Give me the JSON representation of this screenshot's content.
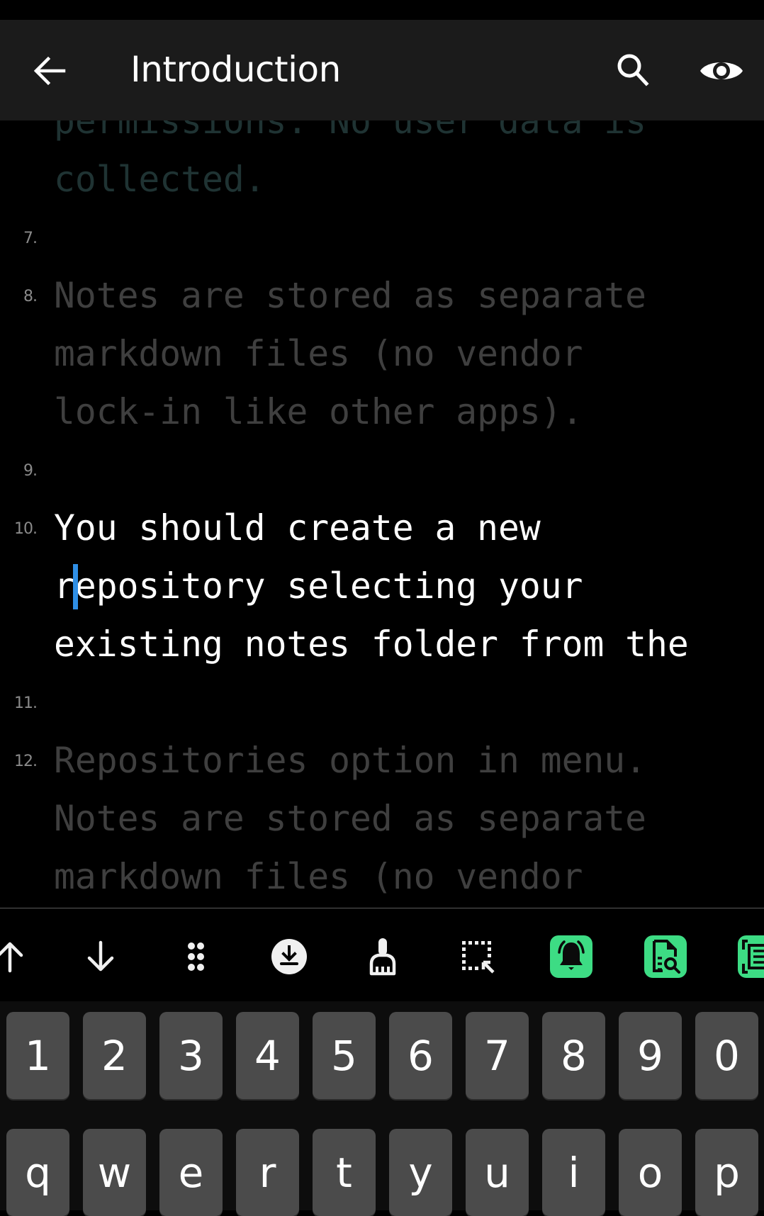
{
  "app_bar": {
    "title": "Introduction",
    "icons": [
      "back-arrow-icon",
      "search-icon",
      "eye-preview-icon"
    ]
  },
  "editor": {
    "lines": [
      {
        "number": "",
        "text": "permissions. No user data is",
        "style": "teal"
      },
      {
        "number": "",
        "text": "collected.",
        "style": "teal"
      },
      {
        "number": "7.",
        "text": "",
        "style": "dim"
      },
      {
        "number": "8.",
        "text": "Notes are stored as separate",
        "style": "dim"
      },
      {
        "number": "",
        "text": "markdown files (no vendor",
        "style": "dim"
      },
      {
        "number": "",
        "text": "lock-in like other apps).",
        "style": "dim"
      },
      {
        "number": "9.",
        "text": "",
        "style": "dim"
      },
      {
        "number": "10.",
        "text": "You should create a new",
        "style": "active"
      },
      {
        "number": "",
        "text": "repository selecting your",
        "style": "active"
      },
      {
        "number": "",
        "text": "existing notes folder from the",
        "style": "active"
      },
      {
        "number": "11.",
        "text": "",
        "style": "dim"
      },
      {
        "number": "12.",
        "text": "Repositories option in menu.",
        "style": "dim"
      },
      {
        "number": "",
        "text": "Notes are stored as separate",
        "style": "dim"
      },
      {
        "number": "",
        "text": "markdown files (no vendor",
        "style": "dim"
      }
    ],
    "cursor": {
      "line_index": 8,
      "char_offset": 1
    },
    "colors": {
      "active_text": "#ffffff",
      "dim_text": "#3f3f3f",
      "teal_text": "#1f3333",
      "line_number": "#8a8a8a",
      "cursor": "#2f8fe6"
    }
  },
  "toolbar": {
    "items": [
      {
        "name": "move-line-up-icon",
        "highlighted": false
      },
      {
        "name": "move-line-down-icon",
        "highlighted": false
      },
      {
        "name": "drag-handle-icon",
        "highlighted": false
      },
      {
        "name": "download-circle-icon",
        "highlighted": false
      },
      {
        "name": "clean-brush-icon",
        "highlighted": false
      },
      {
        "name": "select-area-icon",
        "highlighted": false
      },
      {
        "name": "bell-alarm-icon",
        "highlighted": true
      },
      {
        "name": "document-search-icon",
        "highlighted": true
      },
      {
        "name": "scan-text-icon",
        "highlighted": true
      }
    ],
    "accent_color": "#3ddc84"
  },
  "keyboard": {
    "rows": [
      [
        "1",
        "2",
        "3",
        "4",
        "5",
        "6",
        "7",
        "8",
        "9",
        "0"
      ],
      [
        "q",
        "w",
        "e",
        "r",
        "t",
        "y",
        "u",
        "i",
        "o",
        "p"
      ]
    ]
  }
}
